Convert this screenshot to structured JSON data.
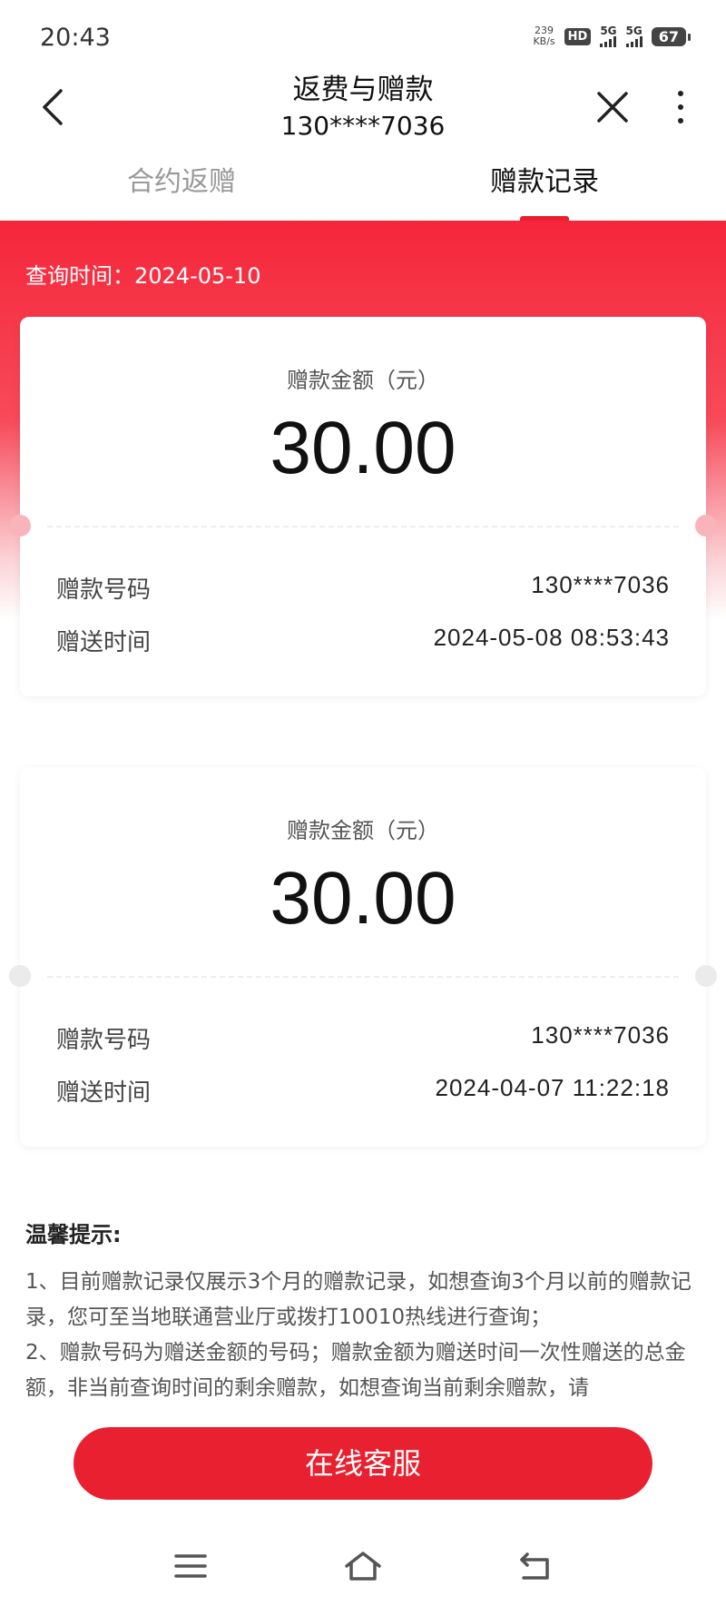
{
  "status_bar": {
    "time": "20:43",
    "net_speed_value": "239",
    "net_speed_unit": "KB/s",
    "hd_label": "HD",
    "sim1_label": "5G",
    "sim2_label": "5G",
    "battery": "67"
  },
  "header": {
    "title": "返费与赠款",
    "subtitle": "130****7036"
  },
  "tabs": [
    {
      "label": "合约返赠",
      "active": false
    },
    {
      "label": "赠款记录",
      "active": true
    }
  ],
  "query_date": "查询时间：2024-05-10",
  "records": [
    {
      "amount_label": "赠款金额（元）",
      "amount": "30.00",
      "number_label": "赠款号码",
      "number": "130****7036",
      "time_label": "赠送时间",
      "time": "2024-05-08 08:53:43"
    },
    {
      "amount_label": "赠款金额（元）",
      "amount": "30.00",
      "number_label": "赠款号码",
      "number": "130****7036",
      "time_label": "赠送时间",
      "time": "2024-04-07 11:22:18"
    }
  ],
  "tips": {
    "title": "温馨提示:",
    "items": [
      "1、目前赠款记录仅展示3个月的赠款记录，如想查询3个月以前的赠款记录，您可至当地联通营业厅或拨打10010热线进行查询；",
      "2、赠款号码为赠送金额的号码；赠款金额为赠送时间一次性赠送的总金额，非当前查询时间的剩余赠款，如想查询当前剩余赠款，请"
    ]
  },
  "button": {
    "label": "在线客服"
  },
  "icons": {
    "back": "back-arrow-icon",
    "close": "close-icon",
    "more": "more-vertical-icon",
    "menu": "menu-icon",
    "home": "home-icon",
    "return": "return-icon"
  },
  "colors": {
    "accent": "#e8202f",
    "header_gradient_top": "#f5263a"
  }
}
